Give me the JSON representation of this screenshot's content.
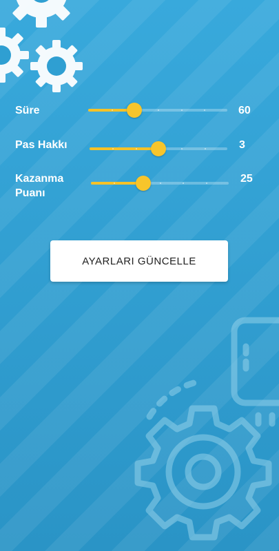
{
  "settings": [
    {
      "label": "Süre",
      "value": "60",
      "fraction": 0.33
    },
    {
      "label": "Pas Hakkı",
      "value": "3",
      "fraction": 0.5
    },
    {
      "label": "Kazanma Puanı",
      "value": "25",
      "fraction": 0.38
    }
  ],
  "update_button": {
    "label": "AYARLARI GÜNCELLE"
  },
  "colors": {
    "background": "#2f9fd2",
    "slider_accent": "#f6c227",
    "button_bg": "#ffffff"
  },
  "icons": [
    "gear-icon",
    "settings-gear-illustration-icon"
  ]
}
